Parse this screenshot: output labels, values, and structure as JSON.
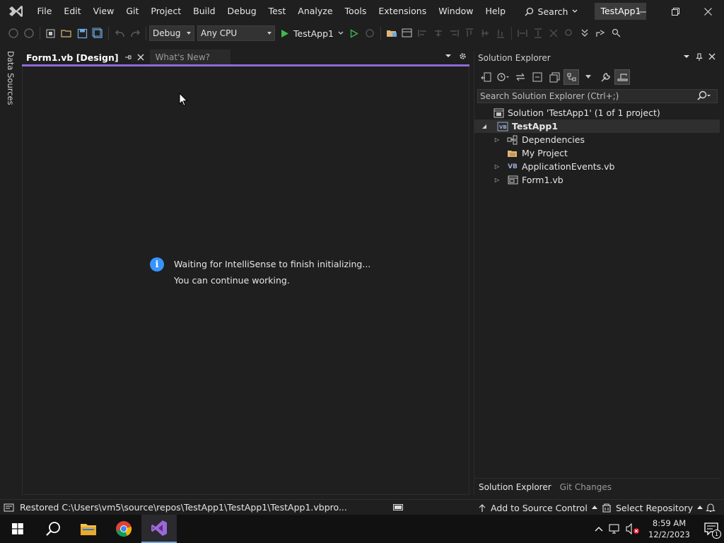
{
  "menubar": {
    "items": [
      "File",
      "Edit",
      "View",
      "Git",
      "Project",
      "Build",
      "Debug",
      "Test",
      "Analyze",
      "Tools",
      "Extensions",
      "Window",
      "Help"
    ],
    "search_label": "Search",
    "solution_name": "TestApp1"
  },
  "toolbar": {
    "configuration": "Debug",
    "platform": "Any CPU",
    "run_target": "TestApp1"
  },
  "left_rail": {
    "label": "Data Sources"
  },
  "editor": {
    "tabs": [
      {
        "label": "Form1.vb [Design]",
        "active": true
      },
      {
        "label": "What's New?",
        "active": false
      }
    ],
    "notification": {
      "line1": "Waiting for IntelliSense to finish initializing...",
      "line2": "You can continue working."
    }
  },
  "solution_explorer": {
    "title": "Solution Explorer",
    "search_placeholder": "Search Solution Explorer (Ctrl+;)",
    "tree": [
      {
        "label": "Solution 'TestApp1' (1 of 1 project)",
        "level": 0,
        "icon": "solution-icon",
        "expander": "none"
      },
      {
        "label": "TestApp1",
        "level": 1,
        "icon": "vb-project-icon",
        "expander": "expanded",
        "bold": true
      },
      {
        "label": "Dependencies",
        "level": 2,
        "icon": "dependencies-icon",
        "expander": "collapsed"
      },
      {
        "label": "My Project",
        "level": 2,
        "icon": "folder-icon",
        "expander": "none"
      },
      {
        "label": "ApplicationEvents.vb",
        "level": 2,
        "icon": "vb-file-icon",
        "expander": "collapsed"
      },
      {
        "label": "Form1.vb",
        "level": 2,
        "icon": "form-icon",
        "expander": "collapsed"
      }
    ],
    "bottom_tabs": [
      "Solution Explorer",
      "Git Changes"
    ]
  },
  "statusbar": {
    "message": "Restored C:\\Users\\vm5\\source\\repos\\TestApp1\\TestApp1\\TestApp1.vbpro...",
    "source_control": "Add to Source Control",
    "repository": "Select Repository"
  },
  "taskbar": {
    "time": "8:59 AM",
    "date": "12/2/2023",
    "notification_count": "1"
  },
  "colors": {
    "accent": "#8f6bd8",
    "info": "#3794ff",
    "run": "#3fb950"
  }
}
